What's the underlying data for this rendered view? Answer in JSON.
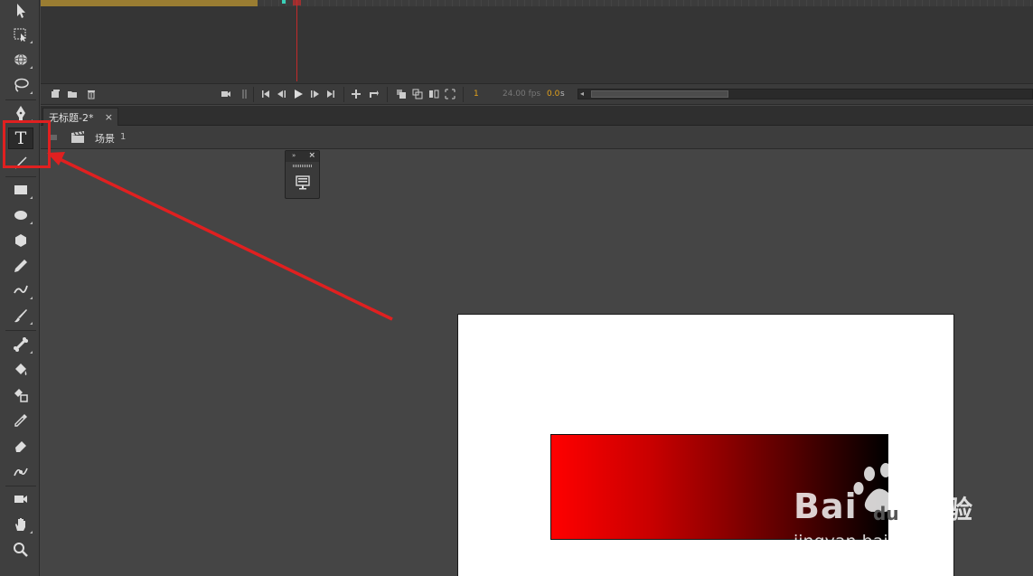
{
  "timeline": {
    "frame_number": "1",
    "fps_label": "24.00 fps",
    "time_value": "0.0",
    "time_unit": "s"
  },
  "document": {
    "tab_title": "无标题-2*",
    "close_glyph": "×"
  },
  "edit_bar": {
    "scene_label": "场景",
    "scene_number": "1"
  },
  "floating_panel": {
    "expand_glyph": "»",
    "close_glyph": "×"
  },
  "tools": [
    {
      "name": "selection-tool",
      "icon": "arrow-icon"
    },
    {
      "name": "free-transform-tool",
      "icon": "free-transform-icon"
    },
    {
      "name": "3d-rotation-tool",
      "icon": "3d-rotation-icon"
    },
    {
      "name": "lasso-tool",
      "icon": "lasso-icon"
    },
    {
      "name": "pen-tool",
      "icon": "pen-icon"
    },
    {
      "name": "text-tool",
      "icon": "text-icon",
      "glyph": "T",
      "selected": true
    },
    {
      "name": "line-tool",
      "icon": "line-icon"
    },
    {
      "name": "rectangle-tool",
      "icon": "rectangle-icon"
    },
    {
      "name": "oval-tool",
      "icon": "oval-icon"
    },
    {
      "name": "polystar-tool",
      "icon": "polygon-icon"
    },
    {
      "name": "pencil-tool",
      "icon": "pencil-icon"
    },
    {
      "name": "paint-brush-tool",
      "icon": "paint-brush-icon"
    },
    {
      "name": "brush-tool",
      "icon": "brush-icon"
    },
    {
      "name": "bone-tool",
      "icon": "bone-icon"
    },
    {
      "name": "paint-bucket-tool",
      "icon": "paint-bucket-icon"
    },
    {
      "name": "ink-bottle-tool",
      "icon": "ink-bottle-icon"
    },
    {
      "name": "eyedropper-tool",
      "icon": "eyedropper-icon"
    },
    {
      "name": "eraser-tool",
      "icon": "eraser-icon"
    },
    {
      "name": "width-tool",
      "icon": "width-icon"
    },
    {
      "name": "camera-tool",
      "icon": "camera-icon"
    },
    {
      "name": "hand-tool",
      "icon": "hand-icon"
    },
    {
      "name": "zoom-tool",
      "icon": "magnifier-icon"
    }
  ],
  "stage": {
    "background": "#ffffff",
    "gradient_start": "#ff0000",
    "gradient_end": "#000000"
  },
  "colors": {
    "annotation": "#e02020",
    "frame_highlight": "#e3a21c",
    "playhead": "#c32a2a"
  },
  "watermark": {
    "brand": "Bai",
    "brand_du": "du",
    "jingyan": "经验",
    "url": "jingyan.baidu.com"
  }
}
